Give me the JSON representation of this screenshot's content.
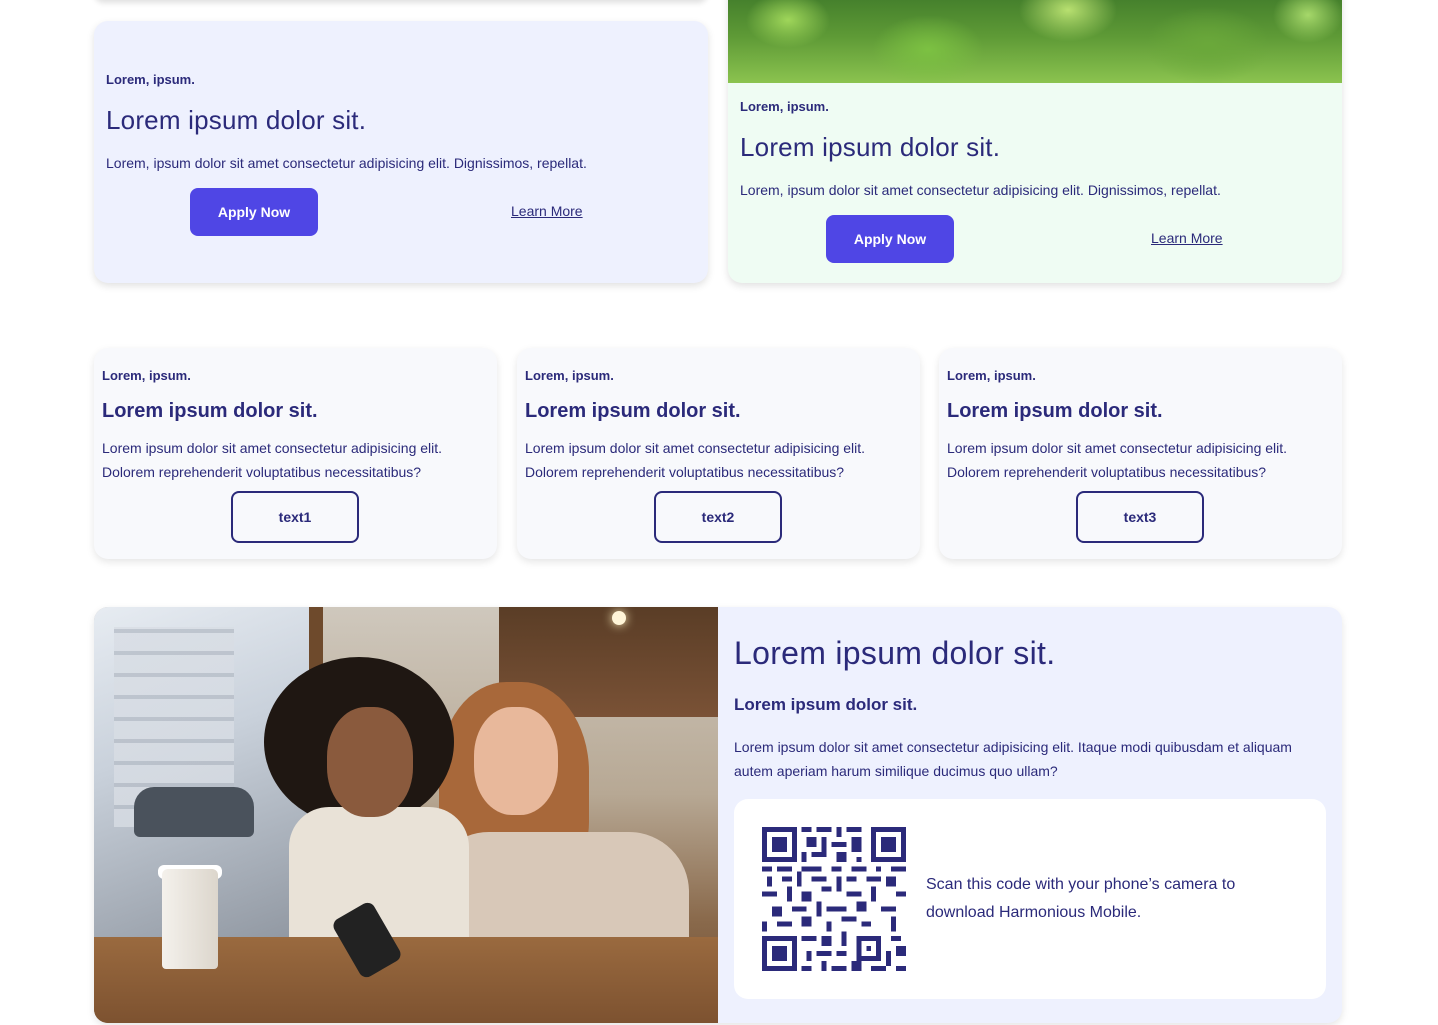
{
  "promo_left": {
    "eyebrow": "Lorem, ipsum.",
    "title": "Lorem ipsum dolor sit.",
    "text": "Lorem, ipsum dolor sit amet consectetur adipisicing elit. Dignissimos, repellat.",
    "primary_label": "Apply Now",
    "secondary_label": "Learn More"
  },
  "promo_right": {
    "eyebrow": "Lorem, ipsum.",
    "title": "Lorem ipsum dolor sit.",
    "text": "Lorem, ipsum dolor sit amet consectetur adipisicing elit. Dignissimos, repellat.",
    "primary_label": "Apply Now",
    "secondary_label": "Learn More"
  },
  "cards": [
    {
      "eyebrow": "Lorem, ipsum.",
      "title": "Lorem ipsum dolor sit.",
      "text": "Lorem ipsum dolor sit amet consectetur adipisicing elit. Dolorem reprehenderit voluptatibus necessitatibus?",
      "button": "text1"
    },
    {
      "eyebrow": "Lorem, ipsum.",
      "title": "Lorem ipsum dolor sit.",
      "text": "Lorem ipsum dolor sit amet consectetur adipisicing elit. Dolorem reprehenderit voluptatibus necessitatibus?",
      "button": "text2"
    },
    {
      "eyebrow": "Lorem, ipsum.",
      "title": "Lorem ipsum dolor sit.",
      "text": "Lorem ipsum dolor sit amet consectetur adipisicing elit. Dolorem reprehenderit voluptatibus necessitatibus?",
      "button": "text3"
    }
  ],
  "feature": {
    "title": "Lorem ipsum dolor sit.",
    "subtitle": "Lorem ipsum dolor sit.",
    "text": "Lorem ipsum dolor sit amet consectetur adipisicing elit. Itaque modi quibusdam et aliquam autem aperiam harum similique ducimus quo ullam?",
    "qr_text": "Scan this code with your phone’s camera to download Harmonious Mobile."
  },
  "colors": {
    "accent": "#4f46e5",
    "text": "#2b2a7a",
    "lavender_bg": "#eef1fe",
    "mint_bg": "#effcf3",
    "card_bg": "#f8f9fc"
  },
  "icons": {
    "qr": "qr-code-icon"
  }
}
